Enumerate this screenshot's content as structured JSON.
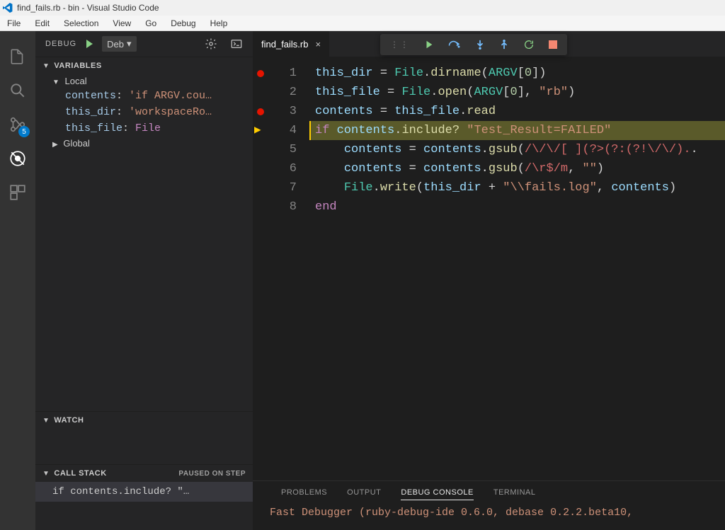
{
  "app": {
    "title": "find_fails.rb - bin - Visual Studio Code"
  },
  "menubar": [
    "File",
    "Edit",
    "Selection",
    "View",
    "Go",
    "Debug",
    "Help"
  ],
  "activitybar": {
    "debug_badge": "5"
  },
  "debug_header": {
    "label": "DEBUG",
    "config": "Deb",
    "caret": "▾"
  },
  "sections": {
    "variables": "VARIABLES",
    "watch": "WATCH",
    "callstack": "CALL STACK",
    "paused_label": "PAUSED ON STEP",
    "scope_local": "Local",
    "scope_global": "Global"
  },
  "variables": [
    {
      "name": "contents",
      "value": "'if ARGV.cou…",
      "type": "str"
    },
    {
      "name": "this_dir",
      "value": "'workspaceRo…",
      "type": "str"
    },
    {
      "name": "this_file",
      "value": "File",
      "type": "type"
    }
  ],
  "callstack": {
    "frame": "if contents.include? \"…"
  },
  "tab": {
    "name": "find_fails.rb",
    "close": "×"
  },
  "code": {
    "current_line": 4,
    "breakpoints": [
      1,
      3
    ],
    "lines": [
      {
        "n": 1,
        "t": [
          [
            "var",
            "this_dir"
          ],
          [
            "assign",
            " = "
          ],
          [
            "const",
            "File"
          ],
          [
            "punc",
            "."
          ],
          [
            "func",
            "dirname"
          ],
          [
            "punc",
            "("
          ],
          [
            "const",
            "ARGV"
          ],
          [
            "punc",
            "["
          ],
          [
            "num",
            "0"
          ],
          [
            "punc",
            "])"
          ]
        ]
      },
      {
        "n": 2,
        "t": [
          [
            "var",
            "this_file"
          ],
          [
            "assign",
            " = "
          ],
          [
            "const",
            "File"
          ],
          [
            "punc",
            "."
          ],
          [
            "func",
            "open"
          ],
          [
            "punc",
            "("
          ],
          [
            "const",
            "ARGV"
          ],
          [
            "punc",
            "["
          ],
          [
            "num",
            "0"
          ],
          [
            "punc",
            "], "
          ],
          [
            "str",
            "\"rb\""
          ],
          [
            "punc",
            ")"
          ]
        ]
      },
      {
        "n": 3,
        "t": [
          [
            "var",
            "contents"
          ],
          [
            "assign",
            " = "
          ],
          [
            "var",
            "this_file"
          ],
          [
            "punc",
            "."
          ],
          [
            "func",
            "read"
          ]
        ]
      },
      {
        "n": 4,
        "t": [
          [
            "kw",
            "if"
          ],
          [
            "punc",
            " "
          ],
          [
            "var",
            "contents"
          ],
          [
            "punc",
            "."
          ],
          [
            "func",
            "include?"
          ],
          [
            "punc",
            " "
          ],
          [
            "str",
            "\"Test_Result=FAILED\""
          ]
        ]
      },
      {
        "n": 5,
        "t": [
          [
            "punc",
            "    "
          ],
          [
            "var",
            "contents"
          ],
          [
            "assign",
            " = "
          ],
          [
            "var",
            "contents"
          ],
          [
            "punc",
            "."
          ],
          [
            "func",
            "gsub"
          ],
          [
            "punc",
            "("
          ],
          [
            "regex",
            "/\\/\\/[ ](?>(?:(?!\\/\\/)."
          ],
          [
            "punc",
            "."
          ]
        ]
      },
      {
        "n": 6,
        "t": [
          [
            "punc",
            "    "
          ],
          [
            "var",
            "contents"
          ],
          [
            "assign",
            " = "
          ],
          [
            "var",
            "contents"
          ],
          [
            "punc",
            "."
          ],
          [
            "func",
            "gsub"
          ],
          [
            "punc",
            "("
          ],
          [
            "regex",
            "/\\r$/m"
          ],
          [
            "punc",
            ", "
          ],
          [
            "str",
            "\"\""
          ],
          [
            "punc",
            ")"
          ]
        ]
      },
      {
        "n": 7,
        "t": [
          [
            "punc",
            "    "
          ],
          [
            "const",
            "File"
          ],
          [
            "punc",
            "."
          ],
          [
            "func",
            "write"
          ],
          [
            "punc",
            "("
          ],
          [
            "var",
            "this_dir"
          ],
          [
            "op",
            " + "
          ],
          [
            "str",
            "\"\\\\fails.log\""
          ],
          [
            "punc",
            ", "
          ],
          [
            "var",
            "contents"
          ],
          [
            "punc",
            ")"
          ]
        ]
      },
      {
        "n": 8,
        "t": [
          [
            "kw",
            "end"
          ]
        ]
      }
    ]
  },
  "panel": {
    "tabs": [
      "PROBLEMS",
      "OUTPUT",
      "DEBUG CONSOLE",
      "TERMINAL"
    ],
    "active": 2,
    "content": "Fast Debugger (ruby-debug-ide 0.6.0, debase 0.2.2.beta10,"
  }
}
